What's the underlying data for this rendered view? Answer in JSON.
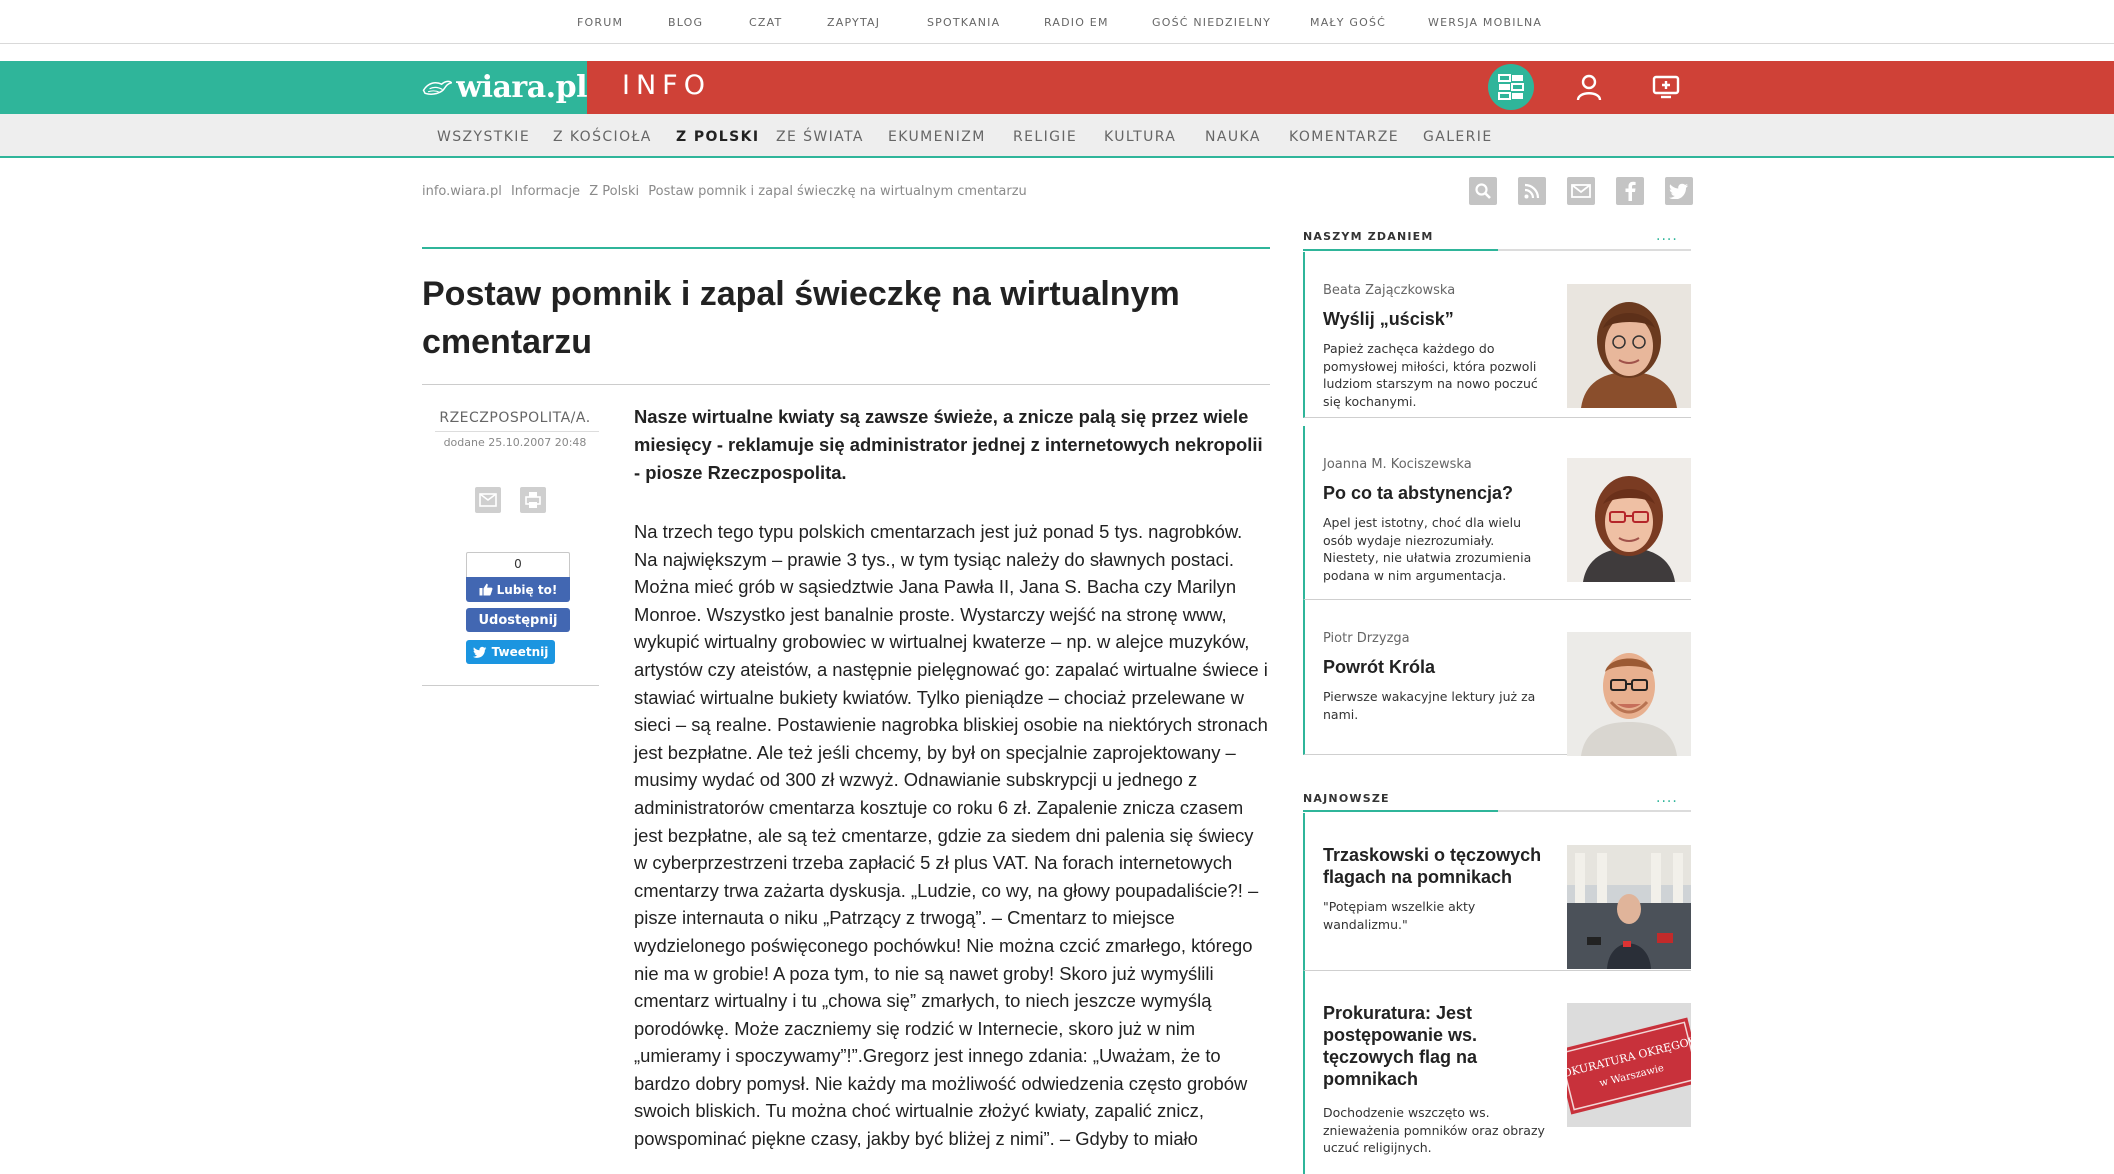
{
  "top_links": [
    "FORUM",
    "BLOG",
    "CZAT",
    "ZAPYTAJ",
    "SPOTKANIA",
    "RADIO EM",
    "GOŚĆ NIEDZIELNY",
    "MAŁY GOŚĆ",
    "WERSJA MOBILNA"
  ],
  "header": {
    "logo_text": "wiara.pl",
    "section_title": "INFO",
    "icons": [
      "apps-icon",
      "user-icon",
      "add-content-icon"
    ]
  },
  "nav": {
    "items": [
      "WSZYSTKIE",
      "Z KOŚCIOŁA",
      "Z POLSKI",
      "ZE ŚWIATA",
      "EKUMENIZM",
      "RELIGIE",
      "KULTURA",
      "NAUKA",
      "KOMENTARZE",
      "GALERIE"
    ],
    "active": "Z POLSKI"
  },
  "breadcrumb": [
    "info.wiara.pl",
    "Informacje",
    "Z Polski",
    "Postaw pomnik i zapal świeczkę na wirtualnym cmentarzu"
  ],
  "tools": [
    "search-icon",
    "rss-icon",
    "mail-icon",
    "facebook-icon",
    "twitter-icon"
  ],
  "article": {
    "title": "Postaw pomnik i zapal świeczkę na wirtualnym cmentarzu",
    "source": "RZECZPOSPOLITA/A.",
    "date": "dodane 25.10.2007 20:48",
    "lead": "Nasze wirtualne kwiaty są zawsze świeże, a znicze palą się przez wiele miesięcy - reklamuje się administrator jednej z internetowych nekropolii - piosze Rzeczpospolita.",
    "body": "Na trzech tego typu polskich cmentarzach jest już ponad 5 tys. nagrobków. Na największym – prawie 3 tys., w tym tysiąc należy do sławnych postaci. Można mieć grób w sąsiedztwie Jana Pawła II, Jana S. Bacha czy Marilyn Monroe. Wszystko jest banalnie proste. Wystarczy wejść na stronę www, wykupić wirtualny grobowiec w wirtualnej kwaterze – np. w alejce muzyków, artystów czy ateistów, a następnie pielęgnować go: zapalać wirtualne świece i stawiać wirtualne bukiety kwiatów. Tylko pieniądze – chociaż przelewane w sieci – są realne. Postawienie nagrobka bliskiej osobie na niektórych stronach jest bezpłatne. Ale też jeśli chcemy, by był on specjalnie zaprojektowany – musimy wydać od 300 zł wzwyż. Odnawianie subskrypcji u jednego z administratorów cmentarza kosztuje co roku 6 zł. Zapalenie znicza czasem jest bezpłatne, ale są też cmentarze, gdzie za siedem dni palenia się świecy w cyberprzestrzeni trzeba zapłacić 5 zł plus VAT. Na forach internetowych cmentarzy trwa zażarta dyskusja. „Ludzie, co wy, na głowy poupadaliście?! – pisze internauta o niku „Patrzący z trwogą”. – Cmentarz to miejsce wydzielonego poświęconego pochówku! Nie można czcić zmarłego, którego nie ma w grobie! A poza tym, to nie są nawet groby! Skoro już wymyślili cmentarz wirtualny i tu „chowa się” zmarłych, to niech jeszcze wymyślą porodówkę. Może zaczniemy się rodzić w Internecie, skoro już w nim „umieramy i spoczywamy”!”.Gregorz jest innego zdania: „Uważam, że to bardzo dobry pomysł. Nie każdy ma możliwość odwiedzenia często grobów swoich bliskich. Tu można choć wirtualnie złożyć kwiaty, zapalić znicz, powspominać piękne czasy, jakby być bliżej z nimi”. – Gdyby to miało"
  },
  "social": {
    "like_count": "0",
    "like_label": "Lubię to!",
    "share_label": "Udostępnij",
    "tweet_label": "Tweetnij"
  },
  "sidebar": {
    "opinion_heading": "NASZYM ZDANIEM",
    "more_dots": "....",
    "opinions": [
      {
        "author": "Beata Zajączkowska",
        "title": "Wyślij „uścisk”",
        "desc": "Papież zachęca każdego do pomysłowej miłości, która pozwoli ludziom starszym na nowo poczuć się kochanymi."
      },
      {
        "author": "Joanna M. Kociszewska",
        "title": "Po co ta abstynencja?",
        "desc": "Apel jest istotny, choć dla wielu osób wydaje niezrozumiały. Niestety, nie ułatwia zrozumienia podana w nim argumentacja."
      },
      {
        "author": "Piotr Drzyzga",
        "title": "Powrót Króla",
        "desc": "Pierwsze wakacyjne lektury już za nami."
      }
    ],
    "newest_heading": "NAJNOWSZE",
    "newest": [
      {
        "title": "Trzaskowski o tęczowych flagach na pomnikach",
        "desc": "\"Potępiam wszelkie akty wandalizmu.\""
      },
      {
        "title": "Prokuratura: Jest postępowanie ws. tęczowych flag na pomnikach",
        "desc": "Dochodzenie wszczęto ws. znieważenia pomników oraz obrazy uczuć religijnych."
      }
    ],
    "sign_text": [
      "PROKURATURA OKRĘGOWA",
      "w Warszawie"
    ]
  },
  "colors": {
    "teal": "#2fb59a",
    "red": "#cf4137",
    "facebook": "#4267b2",
    "twitter": "#1b95e0"
  }
}
